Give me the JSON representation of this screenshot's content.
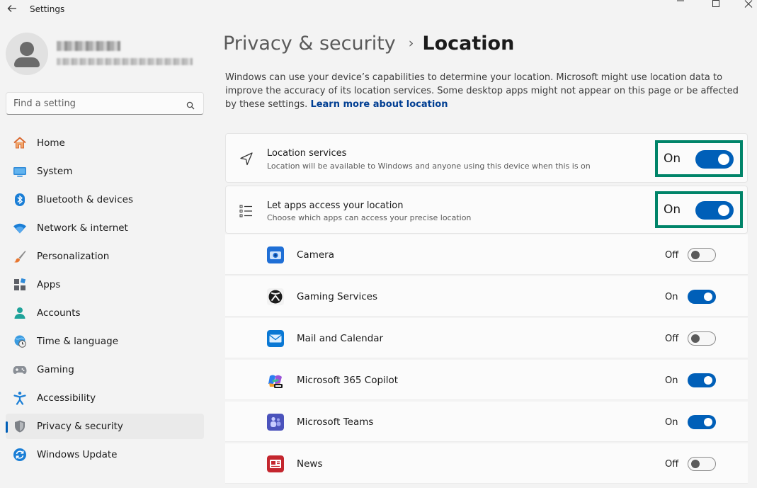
{
  "window": {
    "title": "Settings",
    "back_icon": "back-arrow-icon",
    "controls": [
      "minimize-icon",
      "maximize-icon",
      "close-icon"
    ]
  },
  "search": {
    "placeholder": "Find a setting",
    "icon": "search-icon"
  },
  "sidebar": {
    "items": [
      {
        "label": "Home",
        "icon": "home-icon",
        "active": false
      },
      {
        "label": "System",
        "icon": "system-icon",
        "active": false
      },
      {
        "label": "Bluetooth & devices",
        "icon": "bluetooth-icon",
        "active": false
      },
      {
        "label": "Network & internet",
        "icon": "wifi-icon",
        "active": false
      },
      {
        "label": "Personalization",
        "icon": "brush-icon",
        "active": false
      },
      {
        "label": "Apps",
        "icon": "apps-icon",
        "active": false
      },
      {
        "label": "Accounts",
        "icon": "account-icon",
        "active": false
      },
      {
        "label": "Time & language",
        "icon": "globe-clock-icon",
        "active": false
      },
      {
        "label": "Gaming",
        "icon": "gamepad-icon",
        "active": false
      },
      {
        "label": "Accessibility",
        "icon": "accessibility-icon",
        "active": false
      },
      {
        "label": "Privacy & security",
        "icon": "shield-icon",
        "active": true
      },
      {
        "label": "Windows Update",
        "icon": "update-icon",
        "active": false
      }
    ]
  },
  "breadcrumb": {
    "parent": "Privacy & security",
    "separator": "›",
    "current": "Location"
  },
  "description": {
    "text": "Windows can use your device’s capabilities to determine your location. Microsoft might use location data to improve the accuracy of its location services. Some desktop apps might not appear on this page or be affected by these settings.",
    "link": "Learn more about location"
  },
  "location_services": {
    "title": "Location services",
    "subtitle": "Location will be available to Windows and anyone using this device when this is on",
    "state": "On",
    "icon": "location-arrow-icon",
    "on": true
  },
  "app_access": {
    "title": "Let apps access your location",
    "subtitle": "Choose which apps can access your precise location",
    "state": "On",
    "icon": "list-icon",
    "on": true
  },
  "apps": [
    {
      "name": "Camera",
      "state": "Off",
      "on": false,
      "icon": "camera-icon",
      "color": "#1f6fd6"
    },
    {
      "name": "Gaming Services",
      "state": "On",
      "on": true,
      "icon": "xbox-icon",
      "color": "#1b1b1b"
    },
    {
      "name": "Mail and Calendar",
      "state": "Off",
      "on": false,
      "icon": "mail-icon",
      "color": "#0a78d4"
    },
    {
      "name": "Microsoft 365 Copilot",
      "state": "On",
      "on": true,
      "icon": "copilot-icon",
      "color": "#7b4fd6"
    },
    {
      "name": "Microsoft Teams",
      "state": "On",
      "on": true,
      "icon": "teams-icon",
      "color": "#4b53bc"
    },
    {
      "name": "News",
      "state": "Off",
      "on": false,
      "icon": "news-icon",
      "color": "#c4262e"
    }
  ],
  "colors": {
    "accent": "#005fb8",
    "highlight_border": "#008469",
    "link": "#003e92"
  }
}
